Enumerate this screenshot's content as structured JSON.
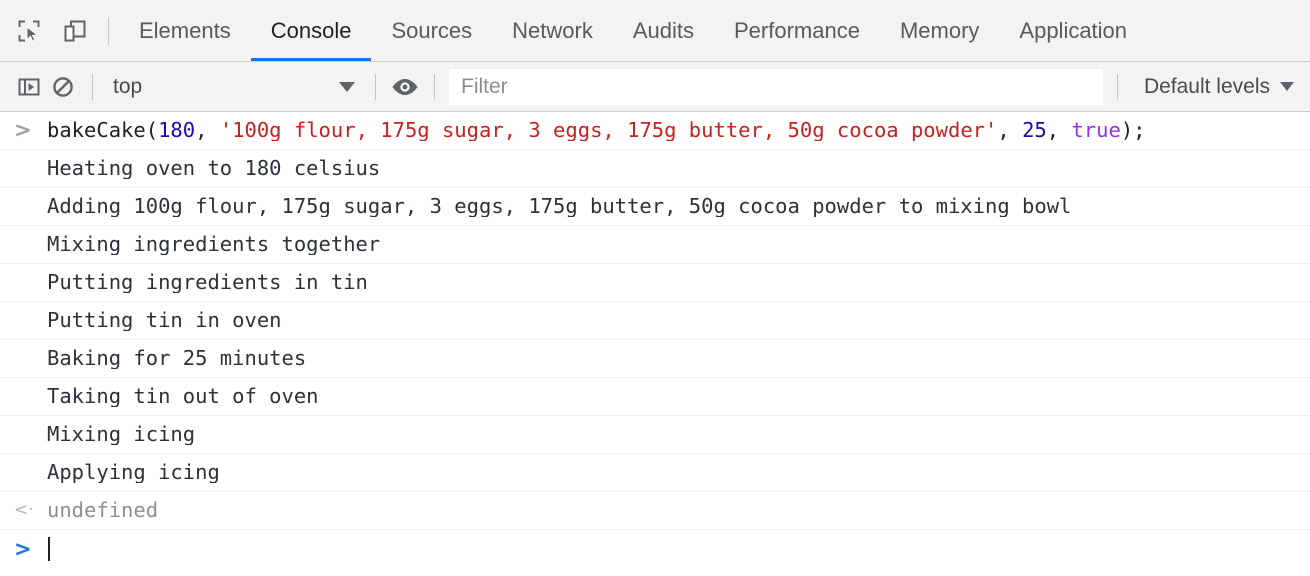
{
  "tabbar": {
    "icons": [
      {
        "name": "inspect-element-icon",
        "title": "Inspect element"
      },
      {
        "name": "device-toolbar-icon",
        "title": "Toggle device toolbar"
      }
    ],
    "tabs": [
      {
        "label": "Elements",
        "active": false
      },
      {
        "label": "Console",
        "active": true
      },
      {
        "label": "Sources",
        "active": false
      },
      {
        "label": "Network",
        "active": false
      },
      {
        "label": "Audits",
        "active": false
      },
      {
        "label": "Performance",
        "active": false
      },
      {
        "label": "Memory",
        "active": false
      },
      {
        "label": "Application",
        "active": false
      }
    ]
  },
  "filterbar": {
    "sidebar_toggle_icon": "show-console-sidebar-icon",
    "clear_icon": "clear-console-icon",
    "context_selected": "top",
    "eye_icon": "live-expressions-eye-icon",
    "filter_placeholder": "Filter",
    "filter_value": "",
    "levels_label": "Default levels"
  },
  "console": {
    "input_marker": ">",
    "result_marker": "<·",
    "input_line": {
      "tokens": [
        {
          "text": "bakeCake(",
          "type": "plain"
        },
        {
          "text": "180",
          "type": "number"
        },
        {
          "text": ", ",
          "type": "plain"
        },
        {
          "text": "'100g flour, 175g sugar, 3 eggs, 175g butter, 50g cocoa powder'",
          "type": "string"
        },
        {
          "text": ", ",
          "type": "plain"
        },
        {
          "text": "25",
          "type": "number"
        },
        {
          "text": ", ",
          "type": "plain"
        },
        {
          "text": "true",
          "type": "boolean"
        },
        {
          "text": ");",
          "type": "plain"
        }
      ],
      "plain_text": "bakeCake(180, '100g flour, 175g sugar, 3 eggs, 175g butter, 50g cocoa powder', 25, true);"
    },
    "log_lines": [
      "Heating oven to 180 celsius",
      "Adding 100g flour, 175g sugar, 3 eggs, 175g butter, 50g cocoa powder to mixing bowl",
      "Mixing ingredients together",
      "Putting ingredients in tin",
      "Putting tin in oven",
      "Baking for 25 minutes",
      "Taking tin out of oven",
      "Mixing icing",
      "Applying icing"
    ],
    "result": "undefined",
    "prompt_value": ""
  },
  "colors": {
    "accent": "#1a73e8",
    "number": "#1a0dab",
    "string": "#c5221f",
    "boolean": "#9334e6",
    "text": "#2b3238",
    "muted": "#8b9095",
    "toolbar_bg": "#f3f3f3"
  }
}
